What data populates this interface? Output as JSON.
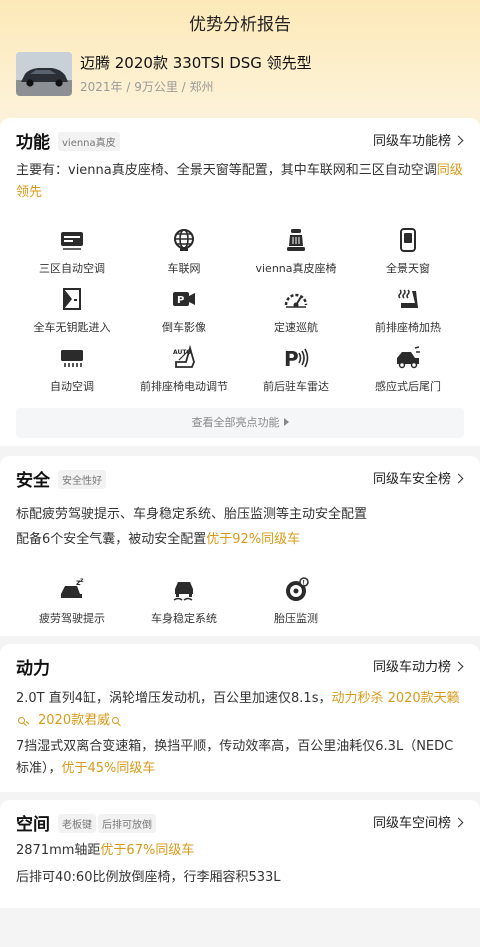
{
  "header": {
    "title": "优势分析报告"
  },
  "car": {
    "name": "迈腾 2020款 330TSI DSG 领先型",
    "meta": "2021年 / 9万公里 / 郑州"
  },
  "function": {
    "title": "功能",
    "tag": "vienna真皮",
    "rank_label": "同级车功能榜",
    "desc_prefix": "主要有：vienna真皮座椅、全景天窗等配置，其中车联网和三区自动空调",
    "desc_highlight": "同级领先",
    "features": [
      {
        "label": "三区自动空调",
        "icon": "ac-panel-icon"
      },
      {
        "label": "车联网",
        "icon": "globe-network-icon"
      },
      {
        "label": "vienna真皮座椅",
        "icon": "leather-seat-icon"
      },
      {
        "label": "全景天窗",
        "icon": "sunroof-icon"
      },
      {
        "label": "全车无钥匙进入",
        "icon": "keyless-door-icon"
      },
      {
        "label": "倒车影像",
        "icon": "reverse-camera-icon"
      },
      {
        "label": "定速巡航",
        "icon": "cruise-control-icon"
      },
      {
        "label": "前排座椅加热",
        "icon": "seat-heating-icon"
      },
      {
        "label": "自动空调",
        "icon": "auto-ac-icon"
      },
      {
        "label": "前排座椅电动调节",
        "icon": "power-seat-icon"
      },
      {
        "label": "前后驻车雷达",
        "icon": "parking-radar-icon"
      },
      {
        "label": "感应式后尾门",
        "icon": "tailgate-sensor-icon"
      }
    ],
    "more_label": "查看全部亮点功能"
  },
  "safety": {
    "title": "安全",
    "tag": "安全性好",
    "rank_label": "同级车安全榜",
    "line1": "标配疲劳驾驶提示、车身稳定系统、胎压监测等主动安全配置",
    "line2_prefix": "配备6个安全气囊，被动安全配置",
    "line2_highlight": "优于92%同级车",
    "features": [
      {
        "label": "疲劳驾驶提示",
        "icon": "fatigue-alert-icon"
      },
      {
        "label": "车身稳定系统",
        "icon": "stability-control-icon"
      },
      {
        "label": "胎压监测",
        "icon": "tire-pressure-icon"
      }
    ]
  },
  "power": {
    "title": "动力",
    "rank_label": "同级车动力榜",
    "line1_prefix": "2.0T 直列4缸，涡轮增压发动机，百公里加速仅8.1s，",
    "line1_highlight_a": "动力秒杀 2020款天籁",
    "line1_sep": "、",
    "line1_highlight_b": "2020款君威",
    "line2_prefix": "7挡湿式双离合变速箱，换挡平顺，传动效率高，百公里油耗仅6.3L（NEDC标准），",
    "line2_highlight": "优于45%同级车"
  },
  "space": {
    "title": "空间",
    "tag1": "老板键",
    "tag2": "后排可放倒",
    "rank_label": "同级车空间榜",
    "line1_prefix": "2871mm轴距",
    "line1_highlight": "优于67%同级车",
    "line2": "后排可40:60比例放倒座椅，行李厢容积533L"
  },
  "colors": {
    "accent": "#d99a18",
    "hero_top": "#fde9b8",
    "bg": "#f4f4f4"
  }
}
